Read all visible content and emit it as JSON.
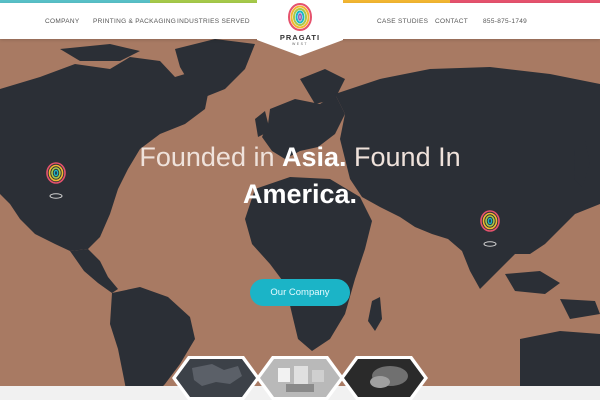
{
  "brand": {
    "name": "PRAGATI",
    "tagline": "WEST",
    "colors": {
      "accent_teal": "#1bb4c7",
      "nav_text": "#555555",
      "map_land": "#2b2f36",
      "map_ocean": "#a87a63"
    }
  },
  "nav": {
    "left": [
      "COMPANY",
      "PRINTING & PACKAGING",
      "INDUSTRIES SERVED"
    ],
    "right": [
      "CASE STUDIES",
      "CONTACT",
      "855-875-1749"
    ]
  },
  "hero": {
    "line1_thin_a": "Founded in ",
    "line1_bold": "Asia.",
    "line1_thin_b": " Found In",
    "line2_bold": "America.",
    "cta_label": "Our Company"
  },
  "icons": {
    "logo": "fingerprint-icon",
    "pin": "map-pin-fingerprint-icon"
  }
}
